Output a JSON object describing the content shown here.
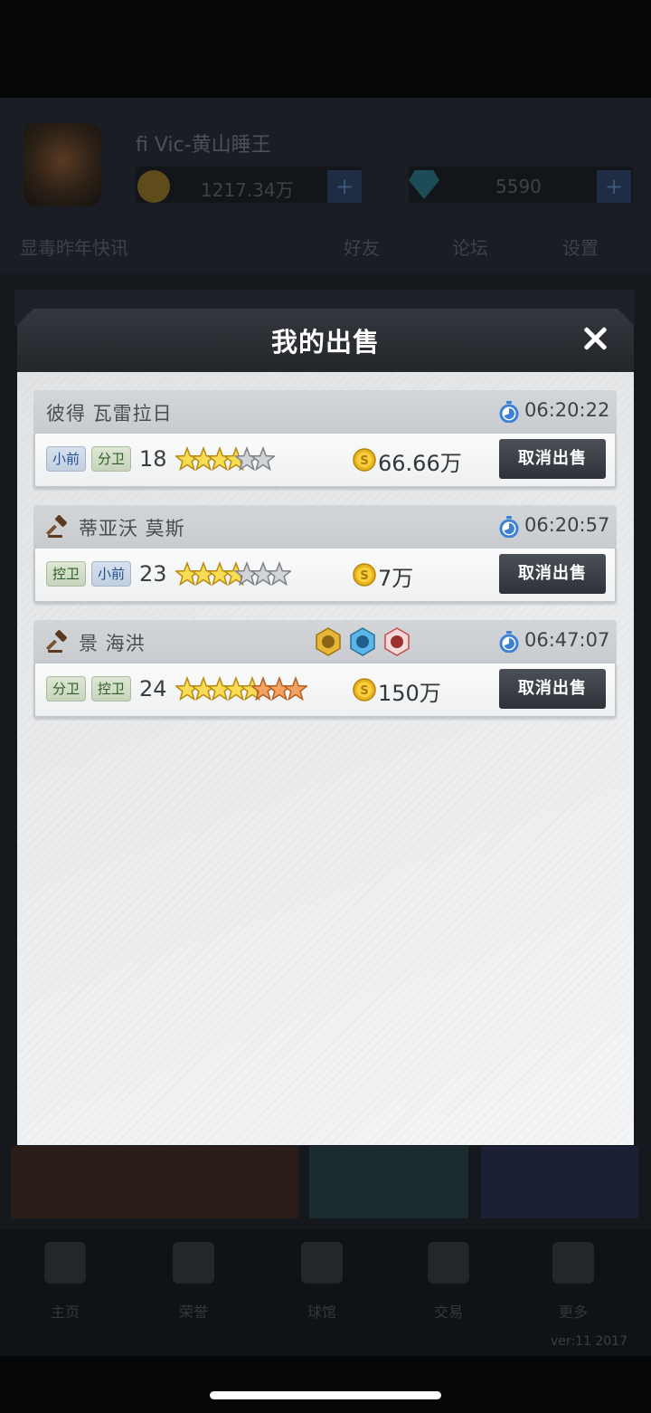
{
  "background": {
    "username": "fi Vic-黄山睡王",
    "coins": "1217.34万",
    "diamonds": "5590",
    "nav": [
      "显毒昨年快讯",
      "好友",
      "论坛",
      "设置"
    ],
    "tabs": [
      "主页",
      "荣誉",
      "球馆",
      "交易",
      "更多"
    ],
    "version": "ver:11 2017"
  },
  "modal": {
    "title": "我的出售",
    "cancel_label": "取消出售",
    "listings": [
      {
        "name": "彼得 瓦雷拉日",
        "auction": false,
        "timer": "06:20:22",
        "positions": [
          {
            "label": "小前",
            "color": "blue"
          },
          {
            "label": "分卫",
            "color": "green"
          }
        ],
        "level": "18",
        "star_rating": {
          "gold": 3.5,
          "silver": 1.5,
          "bronze": 0
        },
        "price": "66.66万",
        "skill_badges": []
      },
      {
        "name": "蒂亚沃 莫斯",
        "auction": true,
        "timer": "06:20:57",
        "positions": [
          {
            "label": "控卫",
            "color": "green"
          },
          {
            "label": "小前",
            "color": "blue"
          }
        ],
        "level": "23",
        "star_rating": {
          "gold": 3.5,
          "silver": 2.5,
          "bronze": 0
        },
        "price": "7万",
        "skill_badges": []
      },
      {
        "name": "景 海洪",
        "auction": true,
        "timer": "06:47:07",
        "positions": [
          {
            "label": "分卫",
            "color": "green"
          },
          {
            "label": "控卫",
            "color": "green"
          }
        ],
        "level": "24",
        "star_rating": {
          "gold": 4.5,
          "silver": 0,
          "bronze": 2.5
        },
        "price": "150万",
        "skill_badges": [
          "gold-hex-badge",
          "blue-hex-badge",
          "red-hex-badge"
        ]
      }
    ]
  }
}
